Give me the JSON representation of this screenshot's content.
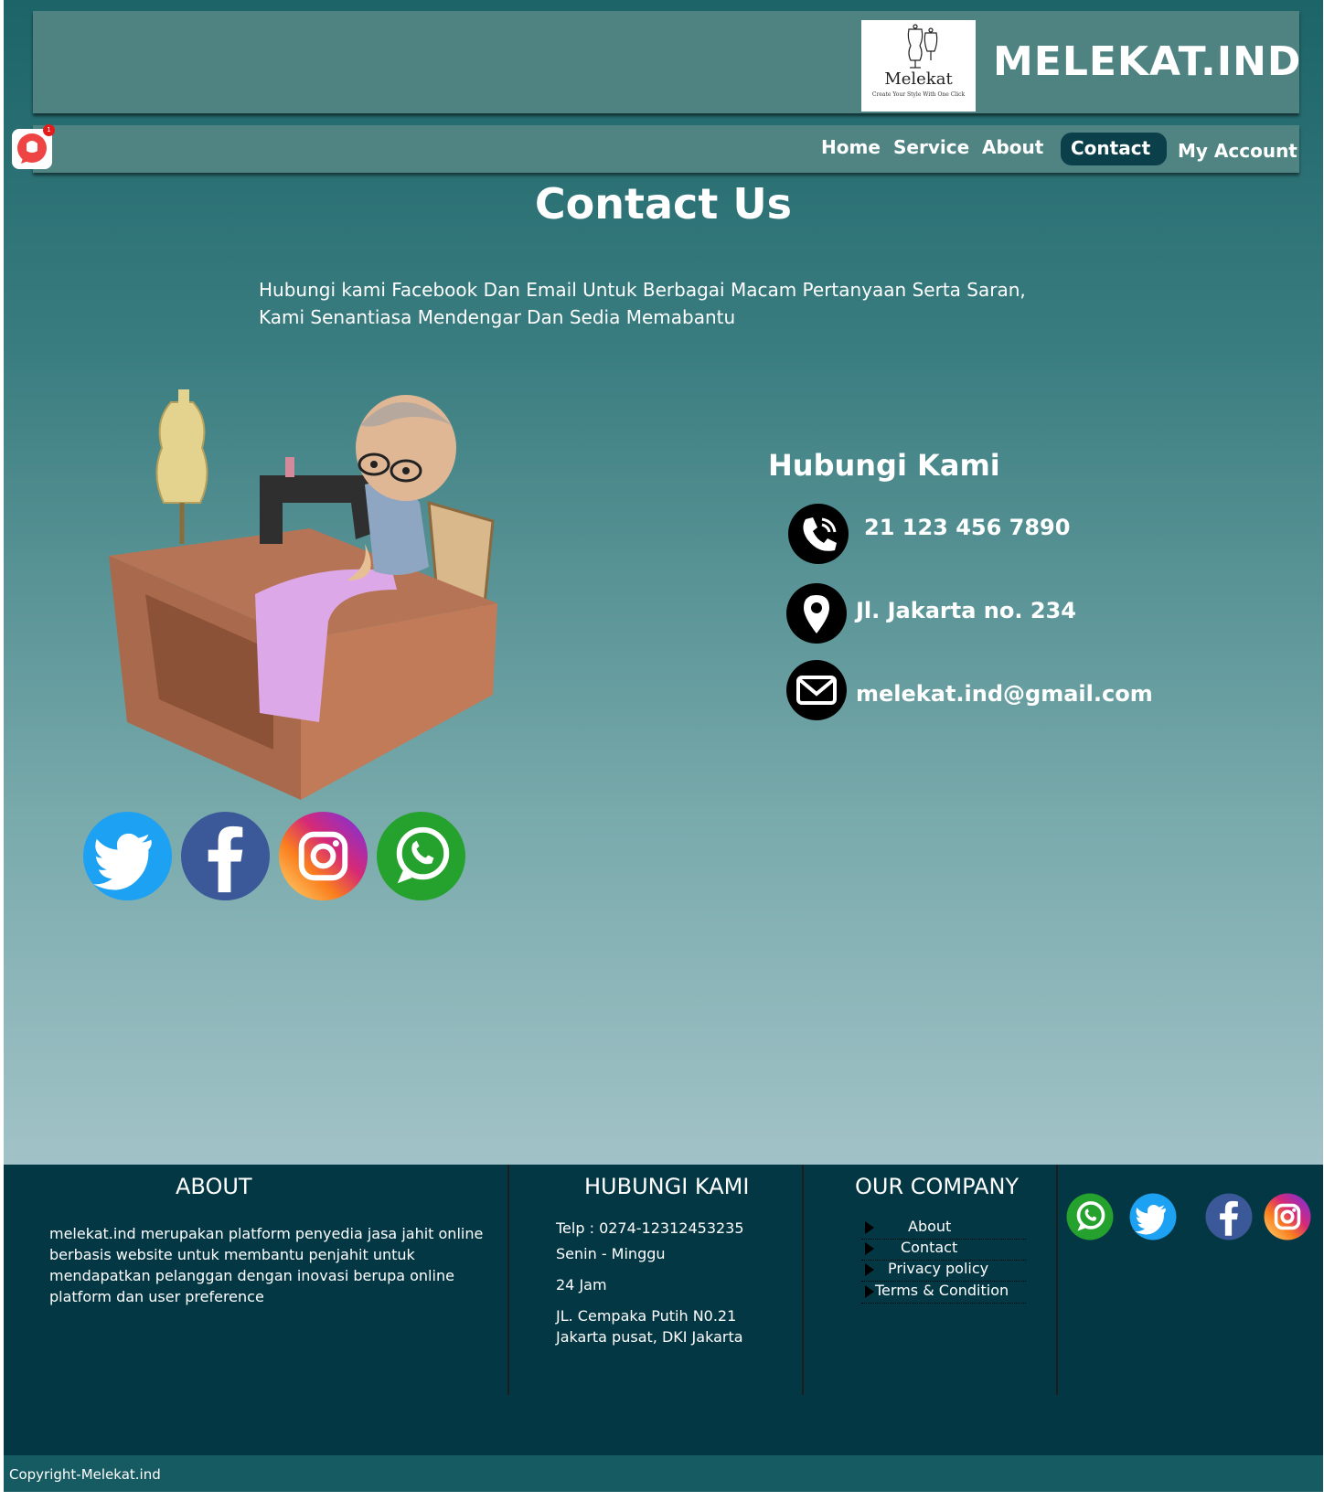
{
  "header": {
    "brand": "MELEKAT.IND",
    "logo_name": "Melekat",
    "logo_tagline": "Create Your Style With One Click"
  },
  "nav": {
    "home": "Home",
    "service": "Service",
    "about": "About",
    "contact": "Contact",
    "account": "My Account",
    "chat_badge": "1"
  },
  "main": {
    "title": "Contact Us",
    "intro_line1": "Hubungi kami Facebook Dan Email Untuk Berbagai Macam Pertanyaan Serta Saran,",
    "intro_line2": "Kami Senantiasa Mendengar Dan Sedia Memabantu",
    "contact_heading": "Hubungi Kami",
    "phone": "21 123 456 7890",
    "address": "Jl. Jakarta no. 234",
    "email": "melekat.ind@gmail.com",
    "socials": [
      "twitter-icon",
      "facebook-icon",
      "instagram-icon",
      "whatsapp-icon"
    ]
  },
  "footer": {
    "about_heading": "ABOUT",
    "about_lines": [
      "melekat.ind merupakan platform penyedia jasa jahit online",
      "berbasis website untuk membantu penjahit untuk",
      "mendapatkan pelanggan dengan inovasi berupa online",
      "platform dan user preference"
    ],
    "contact_heading": "HUBUNGI KAMI",
    "telp": "Telp  :  0274-12312453235",
    "days": "Senin - Minggu",
    "hours": "24 Jam",
    "address1": "JL. Cempaka Putih N0.21",
    "address2": "Jakarta pusat, DKI Jakarta",
    "company_heading": "OUR COMPANY",
    "company_links": [
      "About",
      "Contact",
      "Privacy policy",
      "Terms & Condition"
    ],
    "socials": [
      "whatsapp-icon",
      "twitter-icon",
      "facebook-icon",
      "instagram-icon"
    ],
    "copyright": "Copyright-Melekat.ind"
  },
  "colors": {
    "header": "#4e8381",
    "active_nav": "#0b3f49",
    "footer": "#043744",
    "copyright_bar": "#155b61"
  }
}
